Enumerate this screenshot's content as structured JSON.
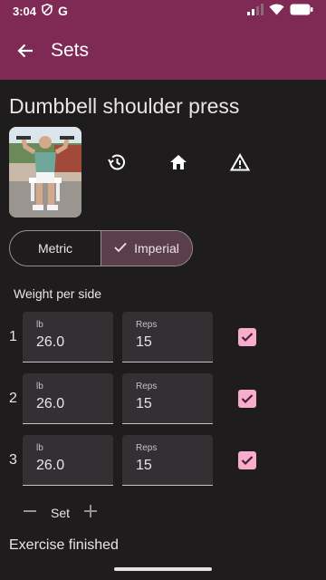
{
  "status_bar": {
    "time": "3:04",
    "icons": [
      "shield-icon",
      "google-g-icon",
      "signal-icon",
      "wifi-icon",
      "battery-icon"
    ],
    "google_letter": "G"
  },
  "app_bar": {
    "title": "Sets",
    "back_icon": "arrow-back-icon",
    "color": "#7e2a55"
  },
  "exercise": {
    "name": "Dumbbell shoulder press",
    "actions": [
      "history-icon",
      "home-icon",
      "warning-icon"
    ]
  },
  "units": {
    "options": [
      "Metric",
      "Imperial"
    ],
    "selected": "Imperial"
  },
  "weight_label": "Weight per side",
  "sets": [
    {
      "number": "1",
      "unit_label": "lb",
      "weight": "26.0",
      "reps_label": "Reps",
      "reps": "15",
      "done": true
    },
    {
      "number": "2",
      "unit_label": "lb",
      "weight": "26.0",
      "reps_label": "Reps",
      "reps": "15",
      "done": true
    },
    {
      "number": "3",
      "unit_label": "lb",
      "weight": "26.0",
      "reps_label": "Reps",
      "reps": "15",
      "done": true
    }
  ],
  "set_controls": {
    "label": "Set"
  },
  "footer": {
    "finished_text": "Exercise finished"
  },
  "colors": {
    "accent": "#f7aecb",
    "background": "#1f1c1e",
    "field": "#332f32"
  }
}
